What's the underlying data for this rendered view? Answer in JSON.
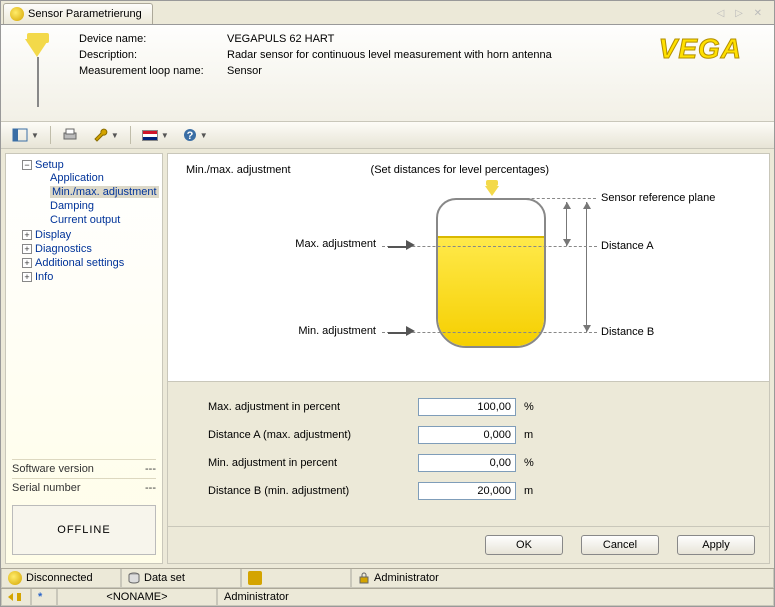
{
  "tab_title": "Sensor Parametrierung",
  "header": {
    "device_name_label": "Device name:",
    "device_name": "VEGAPULS 62 HART",
    "description_label": "Description:",
    "description": "Radar sensor for continuous level measurement with horn antenna",
    "loop_label": "Measurement loop name:",
    "loop": "Sensor",
    "logo": "VEGA"
  },
  "tree": {
    "items": [
      {
        "label": "Setup",
        "expanded": true,
        "children": [
          {
            "label": "Application"
          },
          {
            "label": "Min./max. adjustment",
            "selected": true
          },
          {
            "label": "Damping"
          },
          {
            "label": "Current output"
          }
        ]
      },
      {
        "label": "Display",
        "expanded": false
      },
      {
        "label": "Diagnostics",
        "expanded": false
      },
      {
        "label": "Additional settings",
        "expanded": false
      },
      {
        "label": "Info",
        "expanded": false
      }
    ],
    "sw_label": "Software version",
    "sw_val": "---",
    "sn_label": "Serial number",
    "sn_val": "---",
    "offline": "OFFLINE"
  },
  "content": {
    "title": "Min./max. adjustment",
    "subtitle": "(Set distances for level percentages)",
    "ref_plane": "Sensor reference plane",
    "max_adj": "Max. adjustment",
    "min_adj": "Min. adjustment",
    "dist_a": "Distance A",
    "dist_b": "Distance B"
  },
  "fields": {
    "max_pct_label": "Max. adjustment in percent",
    "max_pct_val": "100,00",
    "dist_a_label": "Distance A (max. adjustment)",
    "dist_a_val": "0,000",
    "min_pct_label": "Min. adjustment in percent",
    "min_pct_val": "0,00",
    "dist_b_label": "Distance B (min. adjustment)",
    "dist_b_val": "20,000",
    "pct_unit": "%",
    "m_unit": "m"
  },
  "buttons": {
    "ok": "OK",
    "cancel": "Cancel",
    "apply": "Apply"
  },
  "status": {
    "disconnected": "Disconnected",
    "dataset": "Data set",
    "admin": "Administrator",
    "noname": "<NONAME>",
    "admin2": "Administrator"
  }
}
